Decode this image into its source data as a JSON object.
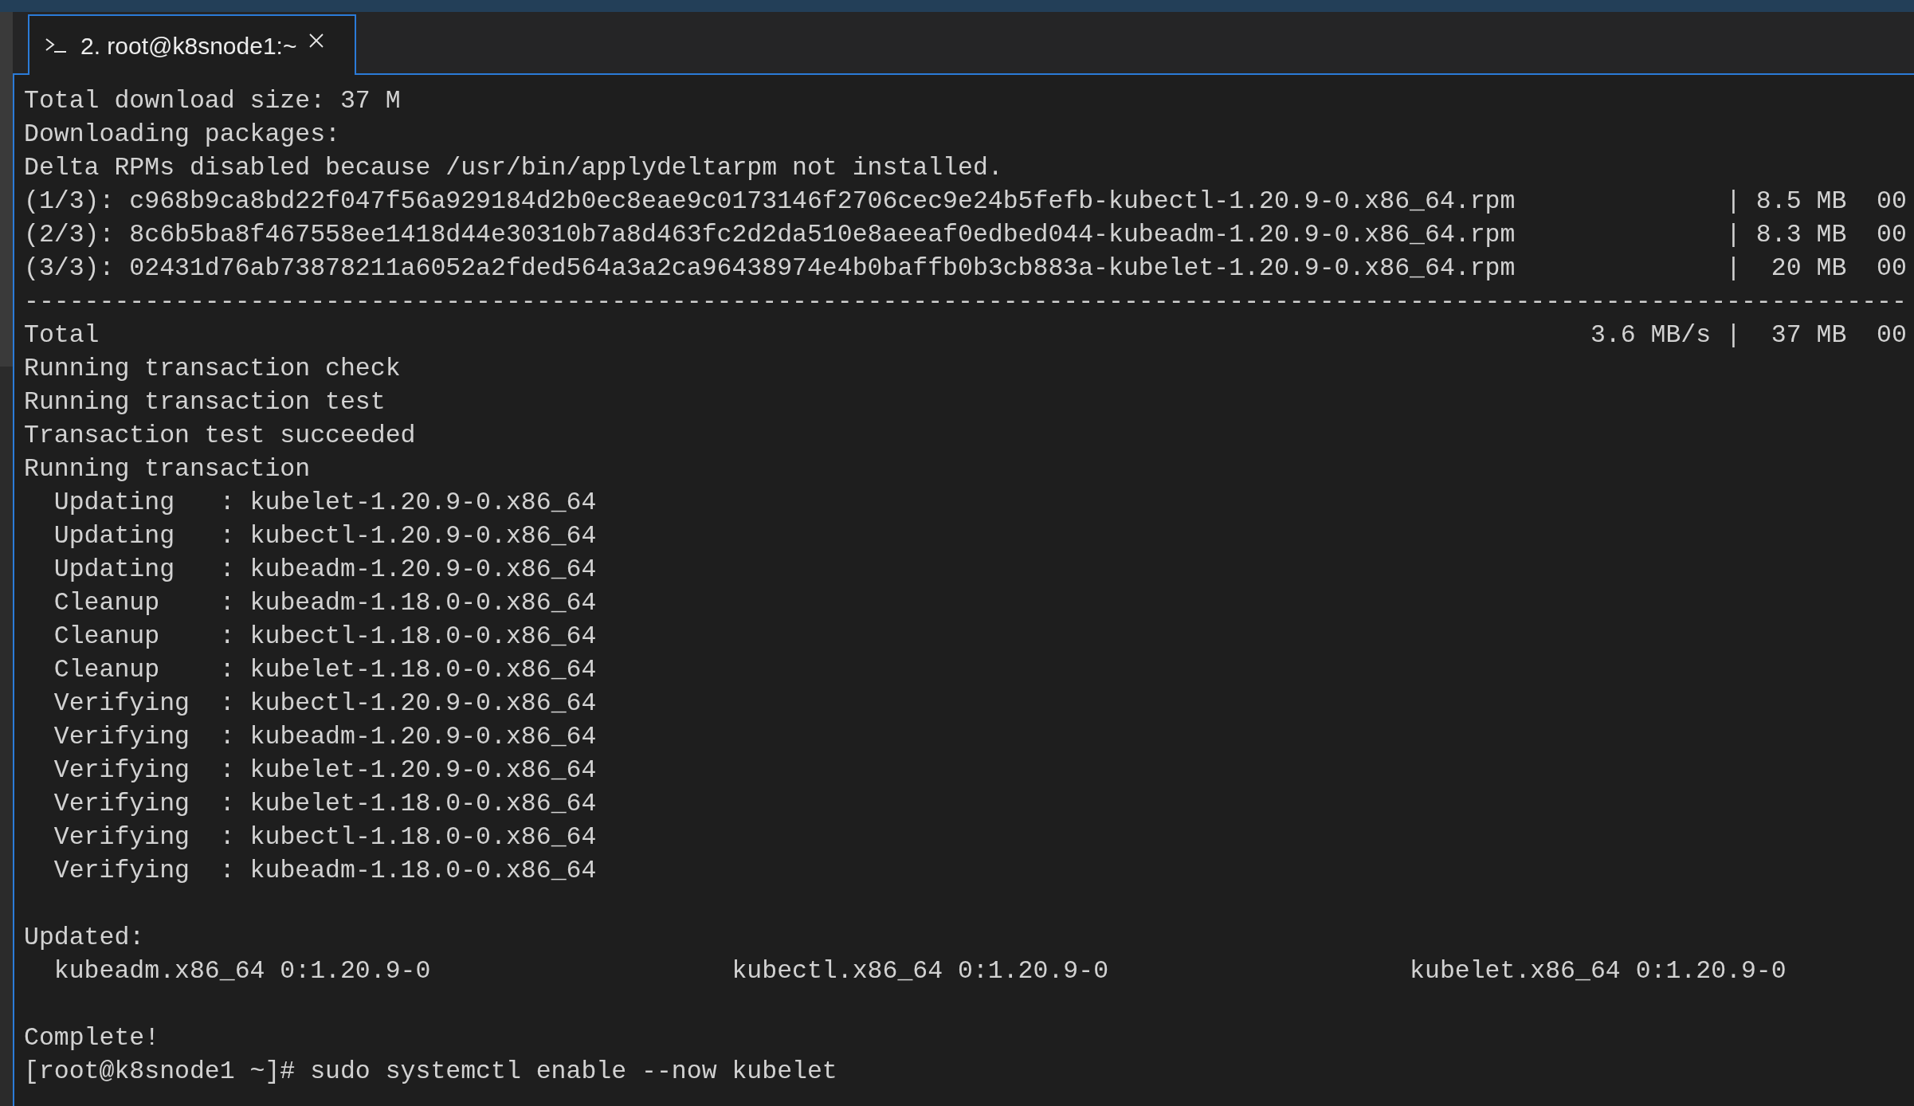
{
  "tabs": [
    {
      "title": "2. root@k8snode1:~",
      "selected": true
    }
  ],
  "terminal": {
    "blocks": [
      {
        "lines": [
          "Total download size: 37 M",
          "Downloading packages:",
          "Delta RPMs disabled because /usr/bin/applydeltarpm not installed.",
          "(1/3): c968b9ca8bd22f047f56a929184d2b0ec8eae9c0173146f2706cec9e24b5fefb-kubectl-1.20.9-0.x86_64.rpm              | 8.5 MB  00",
          "(2/3): 8c6b5ba8f467558ee1418d44e30310b7a8d463fc2d2da510e8aeeaf0edbed044-kubeadm-1.20.9-0.x86_64.rpm              | 8.3 MB  00",
          "(3/3): 02431d76ab73878211a6052a2fded564a3a2ca96438974e4b0baffb0b3cb883a-kubelet-1.20.9-0.x86_64.rpm              |  20 MB  00",
          "-----------------------------------------------------------------------------------------------------------------------------",
          "Total                                                                                                   3.6 MB/s |  37 MB  00",
          "Running transaction check",
          "Running transaction test",
          "Transaction test succeeded",
          "Running transaction",
          "  Updating   : kubelet-1.20.9-0.x86_64",
          "  Updating   : kubectl-1.20.9-0.x86_64",
          "  Updating   : kubeadm-1.20.9-0.x86_64",
          "  Cleanup    : kubeadm-1.18.0-0.x86_64",
          "  Cleanup    : kubectl-1.18.0-0.x86_64",
          "  Cleanup    : kubelet-1.18.0-0.x86_64",
          "  Verifying  : kubectl-1.20.9-0.x86_64",
          "  Verifying  : kubeadm-1.20.9-0.x86_64",
          "  Verifying  : kubelet-1.20.9-0.x86_64",
          "  Verifying  : kubelet-1.18.0-0.x86_64",
          "  Verifying  : kubectl-1.18.0-0.x86_64",
          "  Verifying  : kubeadm-1.18.0-0.x86_64"
        ]
      },
      {
        "lines": [
          "Updated:",
          "  kubeadm.x86_64 0:1.20.9-0                    kubectl.x86_64 0:1.20.9-0                    kubelet.x86_64 0:1.20.9-0"
        ]
      },
      {
        "lines": [
          "Complete!",
          "[root@k8snode1 ~]# sudo systemctl enable --now kubelet"
        ]
      }
    ]
  }
}
